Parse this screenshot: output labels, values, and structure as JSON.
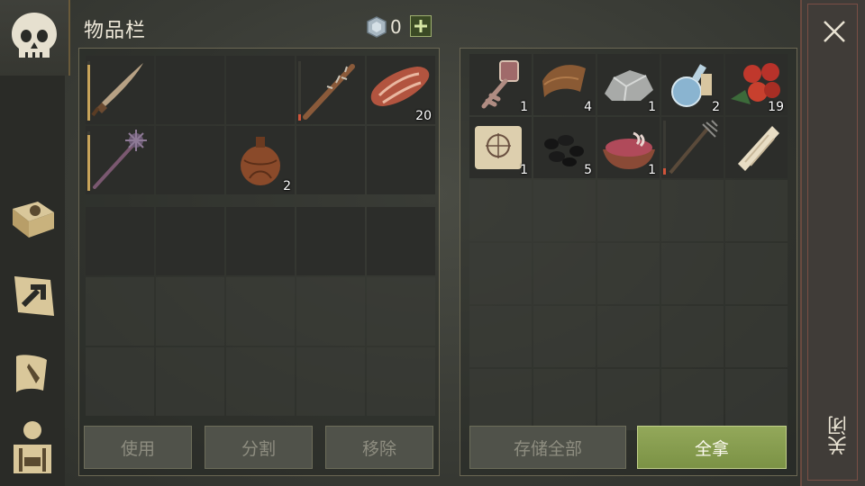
{
  "header": {
    "title": "物品栏",
    "coin_count": "0",
    "add_symbol": "+"
  },
  "inventory": {
    "equipped_slots": [
      {
        "item": "saber",
        "qty": null,
        "durability": 0.95,
        "durability_color": "#c8a45a"
      },
      {
        "item": null
      },
      {
        "item": null
      },
      {
        "item": "spiked-club",
        "qty": null,
        "durability": 0.1,
        "durability_color": "#d0543a"
      },
      {
        "item": "raw-meat",
        "qty": "20"
      },
      {
        "item": "mace",
        "qty": null,
        "durability": 0.95,
        "durability_color": "#c8a45a"
      },
      {
        "item": null
      },
      {
        "item": "water-flask",
        "qty": "2"
      },
      {
        "item": null
      },
      {
        "item": null
      }
    ],
    "buttons": {
      "use": "使用",
      "split": "分割",
      "remove": "移除"
    }
  },
  "container": {
    "slots": [
      {
        "item": "ornate-key",
        "qty": "1"
      },
      {
        "item": "leather",
        "qty": "4"
      },
      {
        "item": "stone",
        "qty": "1"
      },
      {
        "item": "potion-flask",
        "qty": "2"
      },
      {
        "item": "berries",
        "qty": "19"
      },
      {
        "item": "treasure-map",
        "qty": "1"
      },
      {
        "item": "coal",
        "qty": "5"
      },
      {
        "item": "meat-bowl",
        "qty": "1"
      },
      {
        "item": "pitchfork",
        "qty": null,
        "durability": 0.12,
        "durability_color": "#d0543a"
      },
      {
        "item": "bandage-roll",
        "qty": null
      }
    ],
    "buttons": {
      "store_all": "存储全部",
      "take_all": "全拿"
    }
  },
  "sidebar": {
    "tabs": [
      "skull-icon",
      "sun-book-icon",
      "crafting-icon",
      "quest-scroll-icon",
      "character-icon"
    ]
  },
  "close": {
    "label": "关闭"
  },
  "colors": {
    "accent_green": "#8ba24f",
    "panel_border": "#6b6753",
    "close_border": "#7a4e45"
  }
}
